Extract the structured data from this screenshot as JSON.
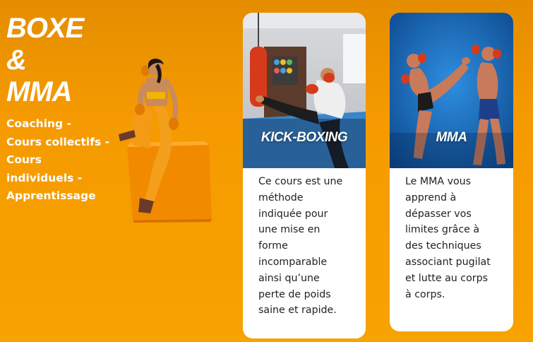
{
  "hero": {
    "title_line1": "BOXE",
    "title_line2": "&",
    "title_line3": "MMA",
    "subtitle_lines": [
      "Coaching -",
      "Cours collectifs -",
      "Cours",
      "individuels -",
      "Apprentissage"
    ]
  },
  "cards": [
    {
      "label": "KICK-BOXING",
      "text_lines": [
        "Ce cours est une",
        "méthode",
        "indiquée pour",
        "une mise en",
        "forme",
        "incomparable",
        "ainsi qu’une",
        "perte de poids",
        "saine et rapide."
      ]
    },
    {
      "label": "MMA",
      "text_lines": [
        "Le MMA vous",
        "apprend à",
        "dépasser vos",
        "limites grâce à",
        "des techniques",
        "associant pugilat",
        "et lutte au corps",
        "à corps."
      ]
    }
  ],
  "colors": {
    "background": "#f59a00",
    "card_bg": "#ffffff",
    "text_dark": "#222222",
    "mma_photo_bg": "#1a63b5"
  },
  "icons": {
    "athlete": "athlete-sitting-image",
    "kick_photo": "kick-boxing-photo",
    "mma_photo": "mma-fighters-photo"
  }
}
